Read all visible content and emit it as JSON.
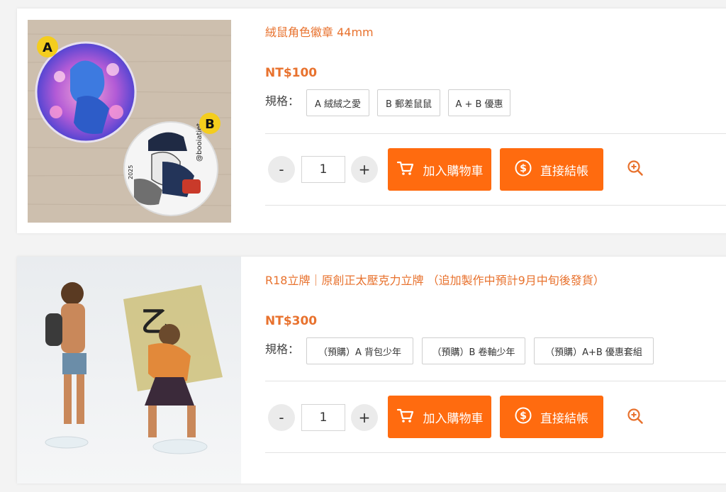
{
  "products": [
    {
      "title": "絨鼠角色徽章 44mm",
      "price": "NT$100",
      "spec_label": "規格：",
      "options": [
        "A 絨絨之愛",
        "B 郵差鼠鼠",
        "A + B 優惠"
      ],
      "quantity": "1",
      "minus_label": "-",
      "plus_label": "+",
      "add_to_cart_label": "加入購物車",
      "checkout_label": "直接結帳",
      "image_text": {
        "label_a": "A",
        "label_b": "B",
        "badge_text": "@booiatiet",
        "year": "2025"
      }
    },
    {
      "title": "R18立牌｜原創正太壓克力立牌 （追加製作中預計9月中旬後發貨）",
      "price": "NT$300",
      "spec_label": "規格：",
      "options": [
        "（預購）A 背包少年",
        "（預購）B 卷軸少年",
        "（預購）A+B 優惠套組"
      ],
      "quantity": "1",
      "minus_label": "-",
      "plus_label": "+",
      "add_to_cart_label": "加入購物車",
      "checkout_label": "直接結帳",
      "image_text": {
        "scroll_glyph": "乙"
      }
    }
  ],
  "colors": {
    "accent": "#ff6b0f",
    "title_text": "#e8722e"
  },
  "icons": {
    "cart": "cart-icon",
    "dollar": "dollar-icon",
    "zoom": "zoom-in-icon"
  }
}
